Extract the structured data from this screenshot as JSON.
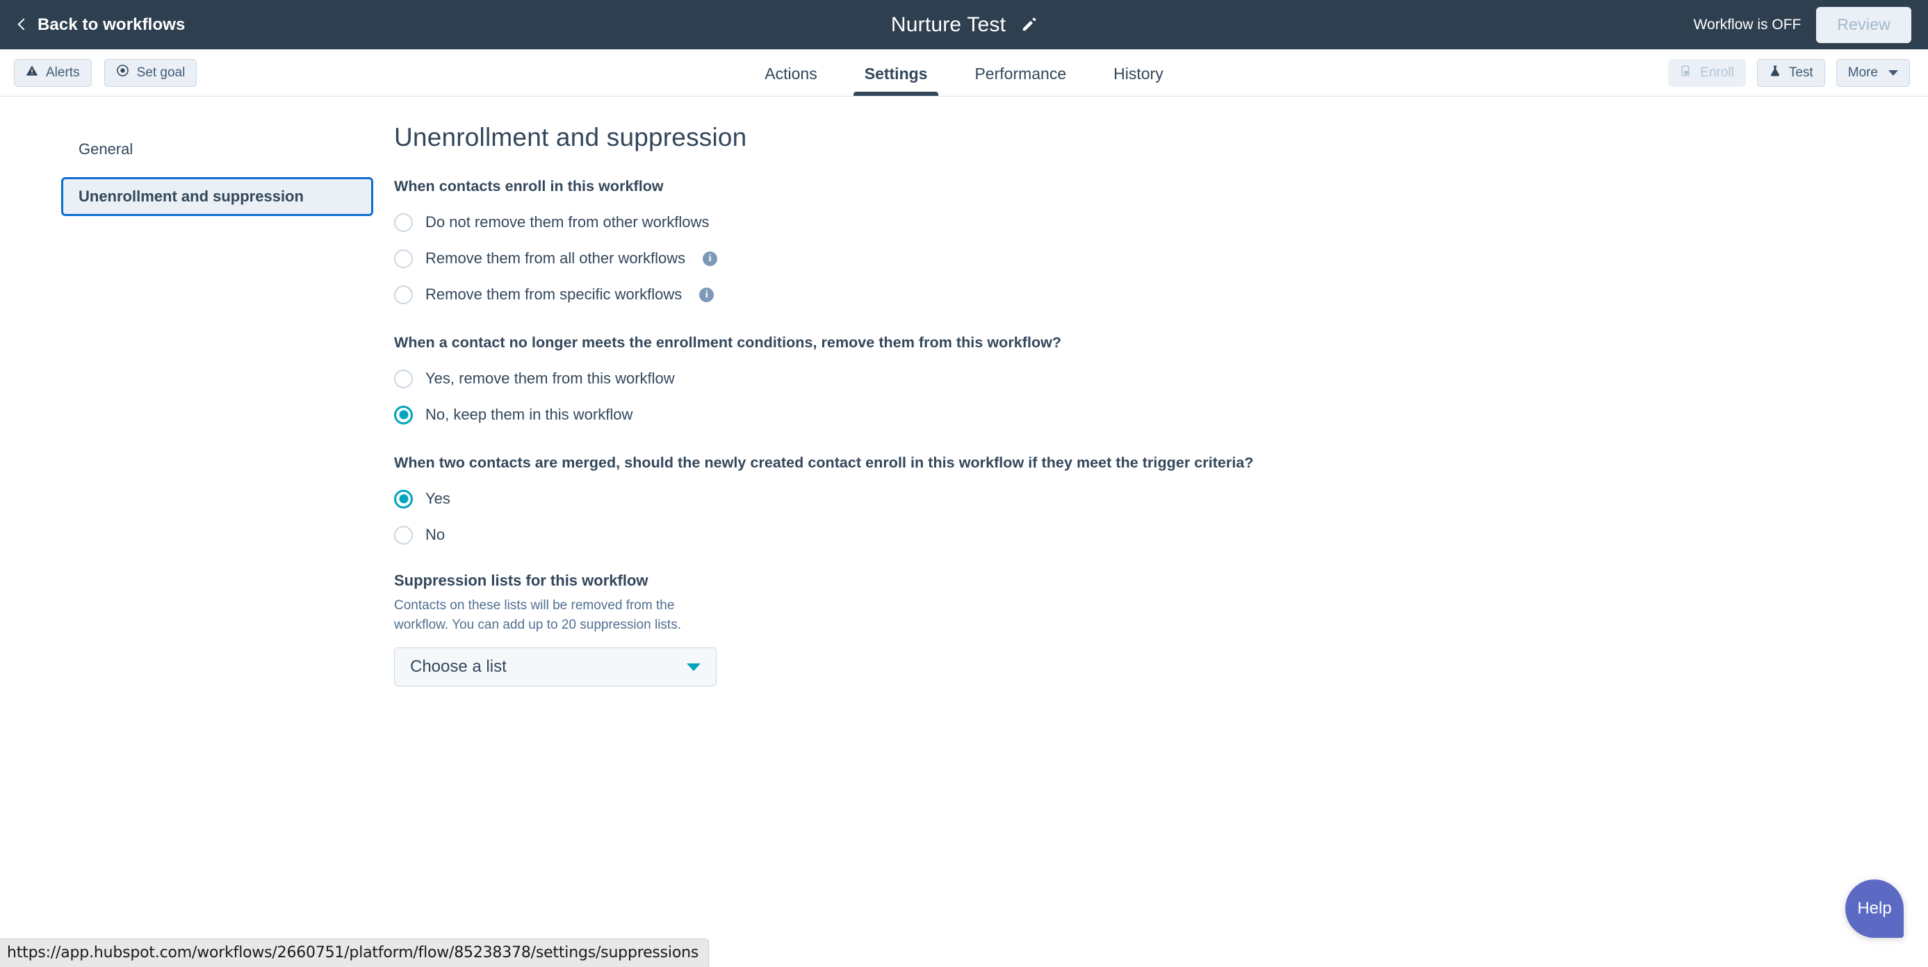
{
  "topbar": {
    "back_label": "Back to workflows",
    "title": "Nurture Test",
    "edit_icon": "pencil-icon",
    "workflow_state": "Workflow is OFF",
    "review_label": "Review"
  },
  "toolbar": {
    "left_buttons": [
      {
        "label": "Alerts",
        "icon": "warning-triangle-icon",
        "disabled": false
      },
      {
        "label": "Set goal",
        "icon": "target-icon",
        "disabled": false
      }
    ],
    "tabs": [
      {
        "label": "Actions",
        "active": false
      },
      {
        "label": "Settings",
        "active": true
      },
      {
        "label": "Performance",
        "active": false
      },
      {
        "label": "History",
        "active": false
      }
    ],
    "right_buttons": [
      {
        "label": "Enroll",
        "icon": "enroll-icon",
        "disabled": true
      },
      {
        "label": "Test",
        "icon": "flask-icon",
        "disabled": false
      },
      {
        "label": "More",
        "icon": "chevron-down-icon",
        "disabled": false
      }
    ]
  },
  "sidebar": {
    "items": [
      {
        "label": "General",
        "selected": false
      },
      {
        "label": "Unenrollment and suppression",
        "selected": true
      }
    ]
  },
  "main": {
    "page_title": "Unenrollment and suppression",
    "groups": [
      {
        "question": "When contacts enroll in this workflow",
        "options": [
          {
            "label": "Do not remove them from other workflows",
            "checked": false,
            "info": false
          },
          {
            "label": "Remove them from all other workflows",
            "checked": false,
            "info": true
          },
          {
            "label": "Remove them from specific workflows",
            "checked": false,
            "info": true
          }
        ]
      },
      {
        "question": "When a contact no longer meets the enrollment conditions, remove them from this workflow?",
        "options": [
          {
            "label": "Yes, remove them from this workflow",
            "checked": false,
            "info": false
          },
          {
            "label": "No, keep them in this workflow",
            "checked": true,
            "info": false
          }
        ]
      },
      {
        "question": "When two contacts are merged, should the newly created contact enroll in this workflow if they meet the trigger criteria?",
        "options": [
          {
            "label": "Yes",
            "checked": true,
            "info": false
          },
          {
            "label": "No",
            "checked": false,
            "info": false
          }
        ]
      }
    ],
    "suppression": {
      "title": "Suppression lists for this workflow",
      "description": "Contacts on these lists will be removed from the workflow. You can add up to 20 suppression lists.",
      "select_value": "Choose a list"
    }
  },
  "help": {
    "label": "Help"
  },
  "status_url": "https://app.hubspot.com/workflows/2660751/platform/flow/85238378/settings/suppressions",
  "colors": {
    "topbar_bg": "#2e3f50",
    "accent_teal": "#00a4bd",
    "focus_blue": "#0d6ecf",
    "text_primary": "#33475b",
    "text_muted": "#516f90",
    "info_icon": "#7c98b6",
    "button_bg": "#eaf0f6",
    "help_purple": "#5c6ac4"
  }
}
